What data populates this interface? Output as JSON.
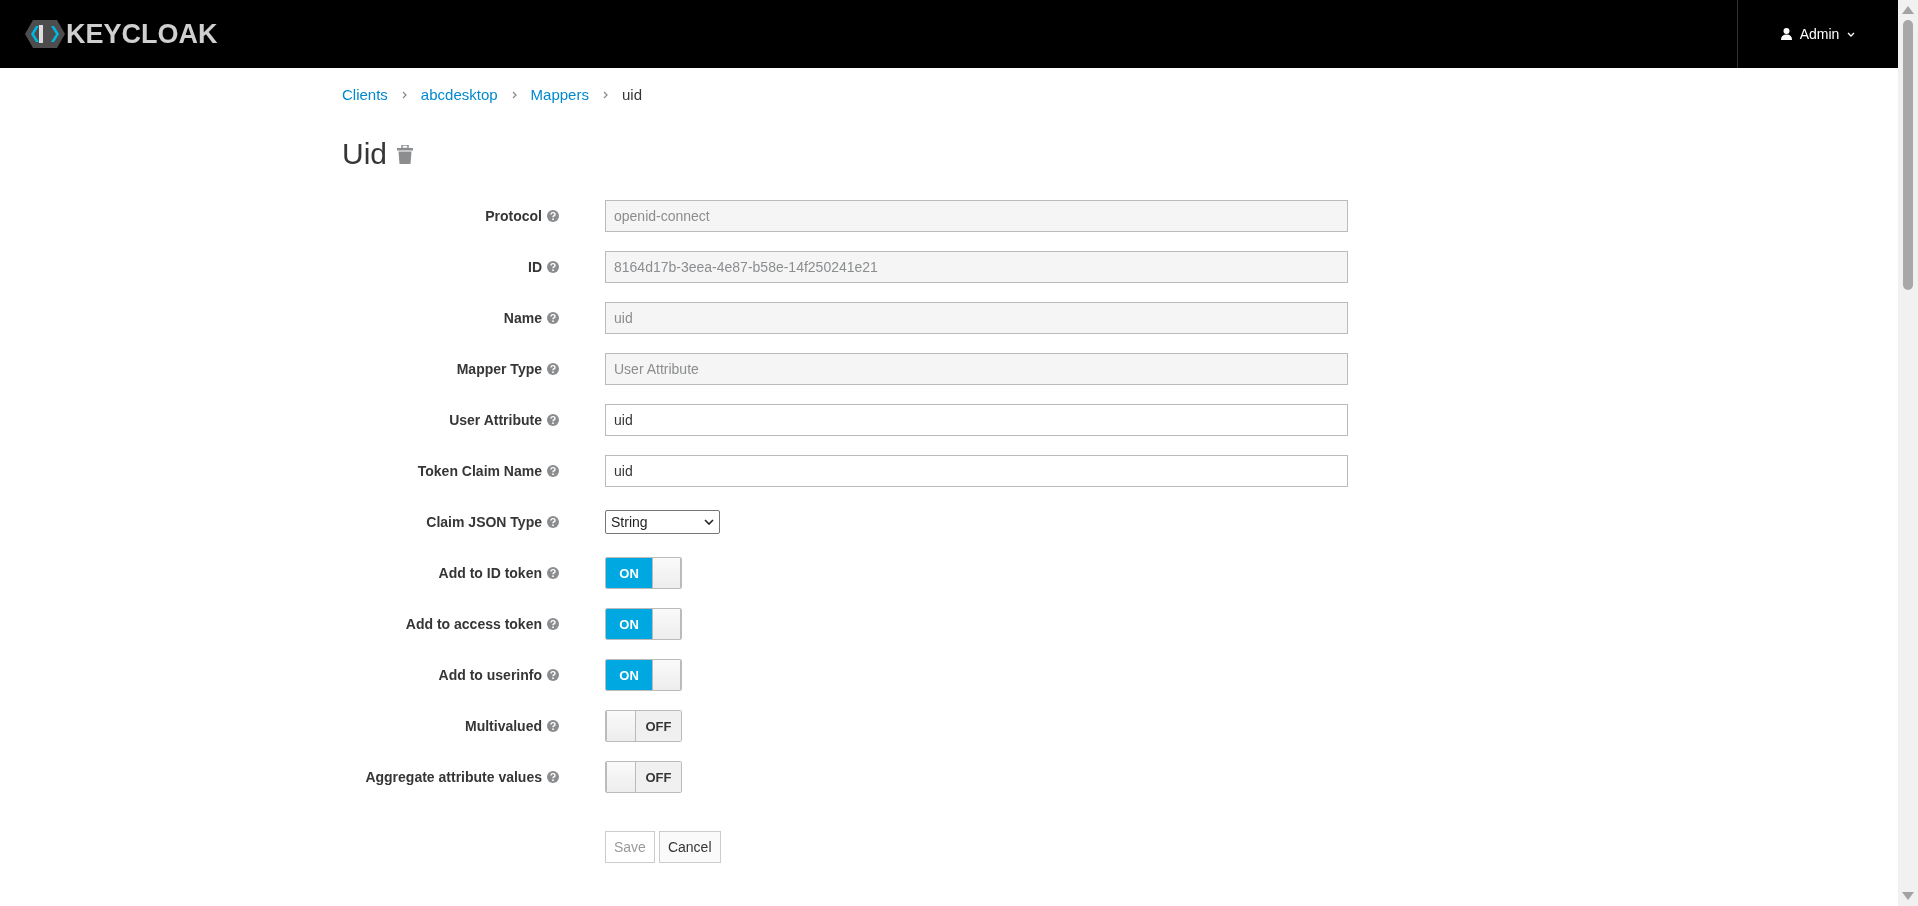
{
  "header": {
    "logo": "KEYCLOAK",
    "user_menu": "Admin"
  },
  "breadcrumb": [
    {
      "label": "Clients",
      "link": true
    },
    {
      "label": "abcdesktop",
      "link": true
    },
    {
      "label": "Mappers",
      "link": true
    },
    {
      "label": "uid",
      "link": false
    }
  ],
  "title": "Uid",
  "fields": [
    {
      "kind": "readonly",
      "label": "Protocol",
      "value": "openid-connect"
    },
    {
      "kind": "readonly",
      "label": "ID",
      "value": "8164d17b-3eea-4e87-b58e-14f250241e21"
    },
    {
      "kind": "readonly",
      "label": "Name",
      "value": "uid"
    },
    {
      "kind": "readonly",
      "label": "Mapper Type",
      "value": "User Attribute"
    },
    {
      "kind": "text",
      "label": "User Attribute",
      "value": "uid"
    },
    {
      "kind": "text",
      "label": "Token Claim Name",
      "value": "uid"
    },
    {
      "kind": "select",
      "label": "Claim JSON Type",
      "value": "String"
    },
    {
      "kind": "switch",
      "label": "Add to ID token",
      "on": true,
      "state_text": "ON"
    },
    {
      "kind": "switch",
      "label": "Add to access token",
      "on": true,
      "state_text": "ON"
    },
    {
      "kind": "switch",
      "label": "Add to userinfo",
      "on": true,
      "state_text": "ON"
    },
    {
      "kind": "switch",
      "label": "Multivalued",
      "on": false,
      "state_text": "OFF"
    },
    {
      "kind": "switch",
      "label": "Aggregate attribute values",
      "on": false,
      "state_text": "OFF"
    }
  ],
  "buttons": [
    {
      "label": "Save",
      "disabled": true
    },
    {
      "label": "Cancel",
      "disabled": false
    }
  ]
}
